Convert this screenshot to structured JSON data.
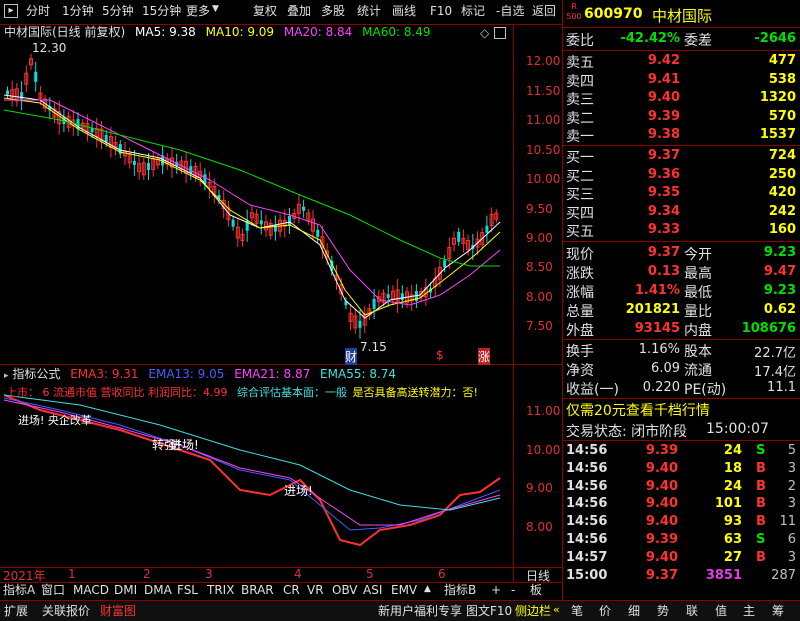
{
  "toolbar": {
    "left": [
      "分时",
      "1分钟",
      "5分钟",
      "15分钟",
      "更多"
    ],
    "right": [
      "复权",
      "叠加",
      "多股",
      "统计",
      "画线",
      "F10",
      "标记",
      "-自选",
      "返回"
    ]
  },
  "main_chart": {
    "title": "中材国际(日线 前复权)",
    "ma_labels": [
      {
        "text": "MA5: 9.38",
        "color": "#ffffff"
      },
      {
        "text": "MA10: 9.09",
        "color": "#ffff00"
      },
      {
        "text": "MA20: 8.84",
        "color": "#ff40ff"
      },
      {
        "text": "MA60: 8.49",
        "color": "#00e000"
      }
    ],
    "high_label": "12.30",
    "low_label": "7.15",
    "y_ticks": [
      "12.00",
      "11.50",
      "11.00",
      "10.50",
      "10.00",
      "9.50",
      "9.00",
      "8.50",
      "8.00",
      "7.50"
    ],
    "markers": [
      "财",
      "$",
      "涨"
    ]
  },
  "indicator_chart": {
    "name": "指标公式",
    "ema_labels": [
      {
        "text": "EMA3: 9.31",
        "color": "#ff3030"
      },
      {
        "text": "EMA13: 9.05",
        "color": "#4060ff"
      },
      {
        "text": "EMA21: 8.87",
        "color": "#ff40ff"
      },
      {
        "text": "EMA55: 8.74",
        "color": "#40e0e0"
      }
    ],
    "info_red": "上市：  6 流通市值 营收同比 利润同比：4.99",
    "info_cyan": "综合评估基本面：一般",
    "info_yellow": "是否具备高送转潜力：否!",
    "left_note": "进场!  央企改革",
    "annotations": [
      "转强!",
      "进场!",
      "进场!"
    ],
    "y_ticks": [
      "11.00",
      "10.00",
      "9.00",
      "8.00"
    ]
  },
  "x_axis": {
    "labels": [
      "2021年",
      "1",
      "2",
      "3",
      "4",
      "5",
      "6"
    ],
    "right_label": "日线"
  },
  "bottom_tabs": [
    "指标A",
    "窗口",
    "MACD",
    "DMI",
    "DMA",
    "FSL",
    "TRIX",
    "BRAR",
    "CR",
    "VR",
    "OBV",
    "ASI",
    "EMV",
    "指标B",
    "+",
    "-",
    "板"
  ],
  "status_bar": {
    "left": [
      "扩展",
      "关联报价",
      "财富图"
    ],
    "right": [
      "新用户福利专享",
      "图文F10",
      "侧边栏"
    ],
    "icons": [
      "笔",
      "价",
      "细",
      "势",
      "联",
      "值",
      "主",
      "筹"
    ]
  },
  "quote_panel": {
    "code": "600970",
    "name": "中材国际",
    "badge_top": "R",
    "badge_bottom": "500",
    "webi_label": "委比",
    "webi_value": "-42.42%",
    "weicha_label": "委差",
    "weicha_value": "-2646",
    "asks": [
      {
        "label": "卖五",
        "price": "9.42",
        "vol": "477"
      },
      {
        "label": "卖四",
        "price": "9.41",
        "vol": "538"
      },
      {
        "label": "卖三",
        "price": "9.40",
        "vol": "1320"
      },
      {
        "label": "卖二",
        "price": "9.39",
        "vol": "570"
      },
      {
        "label": "卖一",
        "price": "9.38",
        "vol": "1537"
      }
    ],
    "bids": [
      {
        "label": "买一",
        "price": "9.37",
        "vol": "724"
      },
      {
        "label": "买二",
        "price": "9.36",
        "vol": "250"
      },
      {
        "label": "买三",
        "price": "9.35",
        "vol": "420"
      },
      {
        "label": "买四",
        "price": "9.34",
        "vol": "242"
      },
      {
        "label": "买五",
        "price": "9.33",
        "vol": "160"
      }
    ],
    "stats": [
      {
        "l1": "现价",
        "v1": "9.37",
        "c1": "#ff3232",
        "l2": "今开",
        "v2": "9.23",
        "c2": "#00e000"
      },
      {
        "l1": "涨跌",
        "v1": "0.13",
        "c1": "#ff3232",
        "l2": "最高",
        "v2": "9.47",
        "c2": "#ff3232"
      },
      {
        "l1": "涨幅",
        "v1": "1.41%",
        "c1": "#ff3232",
        "l2": "最低",
        "v2": "9.23",
        "c2": "#00e000"
      },
      {
        "l1": "总量",
        "v1": "201821",
        "c1": "#ffff00",
        "l2": "量比",
        "v2": "0.62",
        "c2": "#ffff00"
      },
      {
        "l1": "外盘",
        "v1": "93145",
        "c1": "#ff3232",
        "l2": "内盘",
        "v2": "108676",
        "c2": "#00e000"
      }
    ],
    "stats2": [
      {
        "l1": "换手",
        "v1": "1.16%",
        "l2": "股本",
        "v2": "22.7亿"
      },
      {
        "l1": "净资",
        "v1": "6.09",
        "l2": "流通",
        "v2": "17.4亿"
      },
      {
        "l1": "收益(一)",
        "v1": "0.220",
        "l2": "PE(动)",
        "v2": "11.1"
      }
    ],
    "promo": "仅需20元查看千档行情",
    "trade_status_label": "交易状态: 闭市阶段",
    "trade_status_time": "15:00:07",
    "ticks": [
      {
        "time": "14:56",
        "price": "9.39",
        "vol": "24",
        "side": "S",
        "cnt": "5"
      },
      {
        "time": "14:56",
        "price": "9.40",
        "vol": "18",
        "side": "B",
        "cnt": "3"
      },
      {
        "time": "14:56",
        "price": "9.40",
        "vol": "24",
        "side": "B",
        "cnt": "2"
      },
      {
        "time": "14:56",
        "price": "9.40",
        "vol": "101",
        "side": "B",
        "cnt": "3"
      },
      {
        "time": "14:56",
        "price": "9.40",
        "vol": "93",
        "side": "B",
        "cnt": "11"
      },
      {
        "time": "14:56",
        "price": "9.39",
        "vol": "63",
        "side": "S",
        "cnt": "6"
      },
      {
        "time": "14:57",
        "price": "9.40",
        "vol": "27",
        "side": "B",
        "cnt": "3"
      },
      {
        "time": "15:00",
        "price": "9.37",
        "vol": "3851",
        "side": "",
        "cnt": "287"
      }
    ]
  }
}
